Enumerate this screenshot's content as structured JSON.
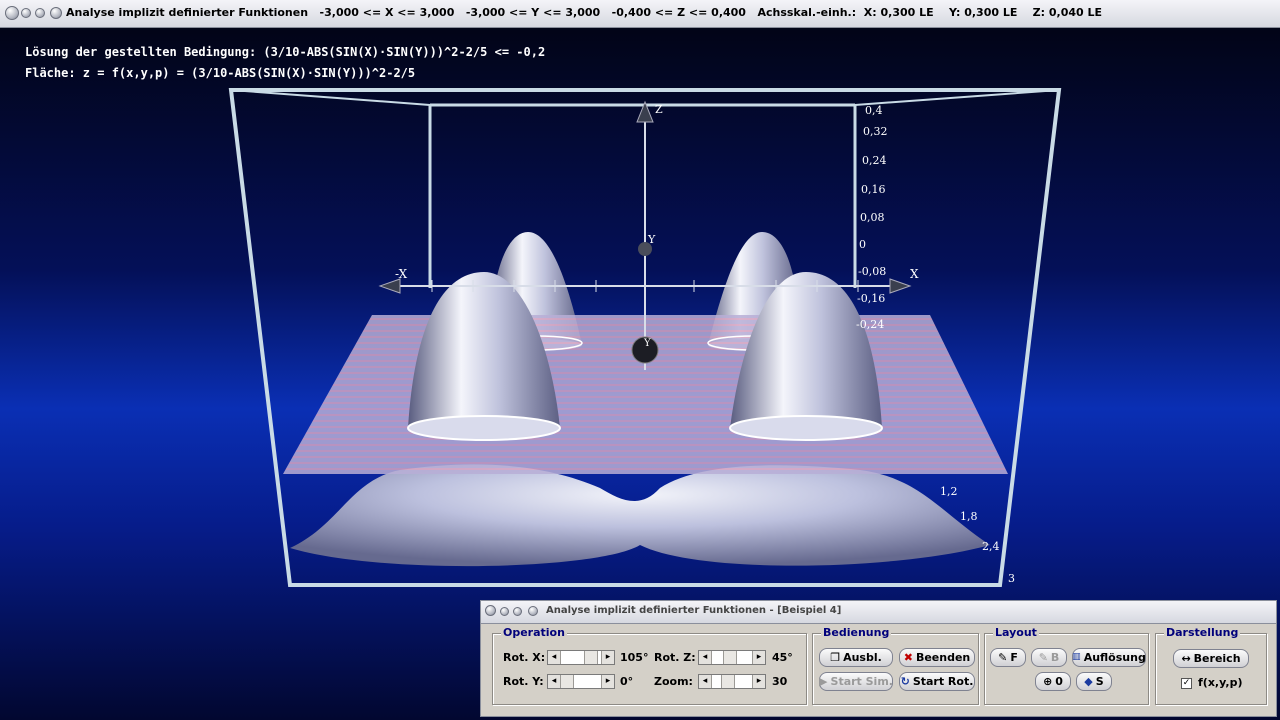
{
  "window": {
    "title": "Analyse implizit definierter Funktionen   -3,000 <= X <= 3,000   -3,000 <= Y <= 3,000   -0,400 <= Z <= 0,400   Achsskal.-einh.:  X: 0,300 LE    Y: 0,300 LE    Z: 0,040 LE"
  },
  "scene": {
    "formula_line1": "Lösung der gestellten Bedingung: (3/10-ABS(SIN(X)·SIN(Y)))^2-2/5 <= -0,2",
    "formula_line2": "Fläche: z = f(x,y,p) = (3/10-ABS(SIN(X)·SIN(Y)))^2-2/5",
    "axis_labels": {
      "neg_x": "-X",
      "pos_x": "X",
      "z": "Z",
      "y": "Y",
      "y_bottom": "Y"
    },
    "z_ticks": [
      "0,4",
      "0,32",
      "0,24",
      "0,16",
      "0,08",
      "0",
      "-0,08",
      "-0,16",
      "-0,24"
    ],
    "y_ticks": [
      "1,2",
      "1,8",
      "2,4",
      "3"
    ]
  },
  "panel": {
    "title": "Analyse implizit definierter Funktionen - [Beispiel 4]",
    "operation": {
      "label": "Operation",
      "rot_x_label": "Rot. X:",
      "rot_x_value": "105°",
      "rot_y_label": "Rot. Y:",
      "rot_y_value": "0°",
      "rot_z_label": "Rot. Z:",
      "rot_z_value": "45°",
      "zoom_label": "Zoom:",
      "zoom_value": "30"
    },
    "bedienung": {
      "label": "Bedienung",
      "ausbl": "Ausbl.",
      "beenden": "Beenden",
      "start_sim": "Start Sim.",
      "start_rot": "Start Rot."
    },
    "layout": {
      "label": "Layout",
      "f": "F",
      "b": "B",
      "aufloesung": "Auflösung",
      "zero": "0",
      "s": "S"
    },
    "darstellung": {
      "label": "Darstellung",
      "bereich": "Bereich",
      "fxyp": "f(x,y,p)"
    }
  },
  "colors": {
    "background_top": "#020417",
    "background_mid": "#0a2fb4",
    "surface": "#b9bdd8",
    "plane": "#b7a3d2",
    "frame": "#c9dbe6",
    "group_label": "#00007b"
  }
}
